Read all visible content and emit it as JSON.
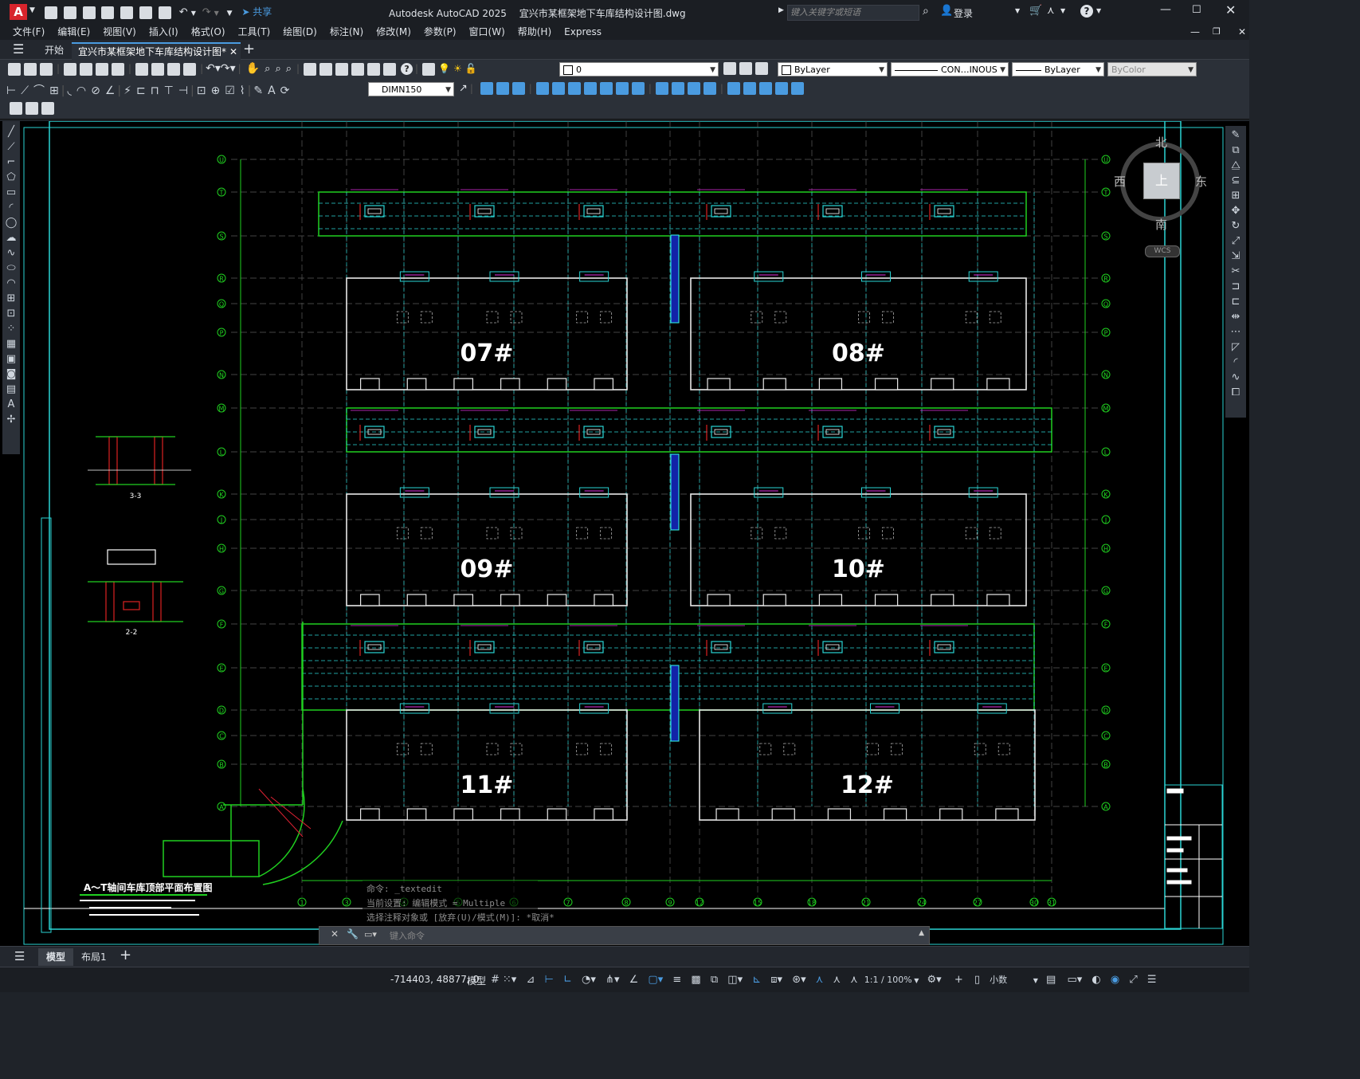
{
  "title": {
    "app": "Autodesk AutoCAD 2025",
    "file": "宜兴市某框架地下车库结构设计图.dwg",
    "share": "共享",
    "search_placeholder": "键入关键字或短语",
    "login": "登录"
  },
  "menu": [
    "文件(F)",
    "编辑(E)",
    "视图(V)",
    "插入(I)",
    "格式(O)",
    "工具(T)",
    "绘图(D)",
    "标注(N)",
    "修改(M)",
    "参数(P)",
    "窗口(W)",
    "帮助(H)",
    "Express"
  ],
  "tabs": {
    "start": "开始",
    "doc": "宜兴市某框架地下车库结构设计图*"
  },
  "toolbar": {
    "layer": "0",
    "color": "ByLayer",
    "linetype": "CON…INOUS",
    "lineweight": "ByLayer",
    "plotstyle": "ByColor",
    "dimstyle": "DIMN150"
  },
  "viewcube": {
    "north": "北",
    "south": "南",
    "east": "东",
    "west": "西",
    "top": "上",
    "wcs": "WCS"
  },
  "drawing": {
    "blocks": [
      "07#",
      "08#",
      "09#",
      "10#",
      "11#",
      "12#"
    ],
    "row_axes": [
      "U",
      "T",
      "S",
      "R",
      "Q",
      "P",
      "N",
      "M",
      "L",
      "K",
      "J",
      "H",
      "G",
      "F",
      "E",
      "D",
      "C",
      "B",
      "A"
    ],
    "col_axes": [
      "1",
      "3",
      "4",
      "5",
      "6",
      "7",
      "8",
      "9",
      "12",
      "15",
      "18",
      "21",
      "24",
      "27",
      "30",
      "31"
    ],
    "section_a": "3-3",
    "section_b": "2-2",
    "plan_title": "A～T轴间车库顶部平面布置图"
  },
  "command": {
    "history1": "命令: _textedit",
    "history2": "当前设置: 编辑模式 = Multiple",
    "history3": "选择注释对象或 [放弃(U)/模式(M)]: *取消*",
    "placeholder": "键入命令"
  },
  "layout_tabs": {
    "model": "模型",
    "layout1": "布局1"
  },
  "status": {
    "coords": "-714403, 48877, 0",
    "model": "模型",
    "scale": "1:1 / 100%",
    "units": "小数"
  }
}
